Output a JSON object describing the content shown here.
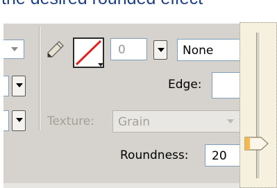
{
  "heading": "the desired rounded effect",
  "toolbar": {
    "stroke_width_value": "0",
    "stroke_style_value": "None",
    "edge_label": "Edge:",
    "texture_label": "Texture:",
    "texture_value": "Grain",
    "roundness_label": "Roundness:",
    "roundness_value": "20"
  },
  "icons": {
    "pencil": "pencil-icon",
    "stroke_color": "stroke-color-swatch",
    "slider": "slider-thumb"
  },
  "colors": {
    "panel_background": "#d6d3ce",
    "slider_background": "#f5f1de",
    "stroke_none_line": "#e0231f",
    "heading_text": "#1f3f86",
    "slider_thumb": "#f5b84a"
  }
}
